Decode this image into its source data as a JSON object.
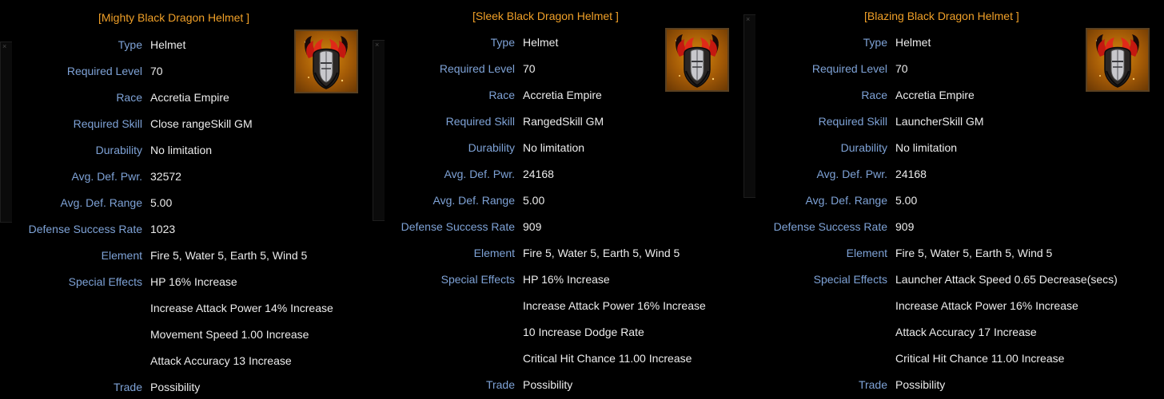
{
  "colors": {
    "background": "#000000",
    "title": "#f0a028",
    "label": "#7ea2d6",
    "value": "#ececec",
    "icon_bg": "#c07010"
  },
  "items": [
    {
      "title": "[Mighty Black Dragon Helmet ]",
      "icon": "black-dragon-helmet-icon",
      "rows": [
        {
          "label": "Type",
          "value": "Helmet"
        },
        {
          "label": "Required Level",
          "value": "70"
        },
        {
          "label": "Race",
          "value": "Accretia Empire"
        },
        {
          "label": "Required Skill",
          "value": "Close rangeSkill GM"
        },
        {
          "label": "Durability",
          "value": "No limitation"
        },
        {
          "label": "Avg. Def. Pwr.",
          "value": "32572"
        },
        {
          "label": "Avg. Def. Range",
          "value": "5.00"
        },
        {
          "label": "Defense Success Rate",
          "value": "1023"
        },
        {
          "label": "Element",
          "value": "Fire 5, Water 5, Earth 5, Wind 5"
        },
        {
          "label": "Special Effects",
          "value": "HP 16% Increase"
        },
        {
          "label": "",
          "value": "Increase Attack Power 14% Increase"
        },
        {
          "label": "",
          "value": "Movement Speed 1.00 Increase"
        },
        {
          "label": "",
          "value": "Attack Accuracy 13 Increase"
        },
        {
          "label": "Trade",
          "value": "Possibility"
        }
      ]
    },
    {
      "title": "[Sleek Black Dragon Helmet ]",
      "icon": "black-dragon-helmet-icon",
      "rows": [
        {
          "label": "Type",
          "value": "Helmet"
        },
        {
          "label": "Required Level",
          "value": "70"
        },
        {
          "label": "Race",
          "value": "Accretia Empire"
        },
        {
          "label": "Required Skill",
          "value": "RangedSkill GM"
        },
        {
          "label": "Durability",
          "value": "No limitation"
        },
        {
          "label": "Avg. Def. Pwr.",
          "value": "24168"
        },
        {
          "label": "Avg. Def. Range",
          "value": "5.00"
        },
        {
          "label": "Defense Success Rate",
          "value": "909"
        },
        {
          "label": "Element",
          "value": "Fire 5, Water 5, Earth 5, Wind 5"
        },
        {
          "label": "Special Effects",
          "value": "HP 16% Increase"
        },
        {
          "label": "",
          "value": "Increase Attack Power 16% Increase"
        },
        {
          "label": "",
          "value": "10 Increase Dodge Rate"
        },
        {
          "label": "",
          "value": "Critical Hit Chance 11.00 Increase"
        },
        {
          "label": "Trade",
          "value": "Possibility"
        }
      ]
    },
    {
      "title": "[Blazing Black Dragon Helmet ]",
      "icon": "black-dragon-helmet-icon",
      "rows": [
        {
          "label": "Type",
          "value": "Helmet"
        },
        {
          "label": "Required Level",
          "value": "70"
        },
        {
          "label": "Race",
          "value": "Accretia Empire"
        },
        {
          "label": "Required Skill",
          "value": "LauncherSkill GM"
        },
        {
          "label": "Durability",
          "value": "No limitation"
        },
        {
          "label": "Avg. Def. Pwr.",
          "value": "24168"
        },
        {
          "label": "Avg. Def. Range",
          "value": "5.00"
        },
        {
          "label": "Defense Success Rate",
          "value": "909"
        },
        {
          "label": "Element",
          "value": "Fire 5, Water 5, Earth 5, Wind 5"
        },
        {
          "label": "Special Effects",
          "value": "Launcher Attack Speed 0.65 Decrease(secs)"
        },
        {
          "label": "",
          "value": "Increase Attack Power 16% Increase"
        },
        {
          "label": "",
          "value": "Attack Accuracy 17 Increase"
        },
        {
          "label": "",
          "value": "Critical Hit Chance 11.00 Increase"
        },
        {
          "label": "Trade",
          "value": "Possibility"
        }
      ]
    }
  ]
}
